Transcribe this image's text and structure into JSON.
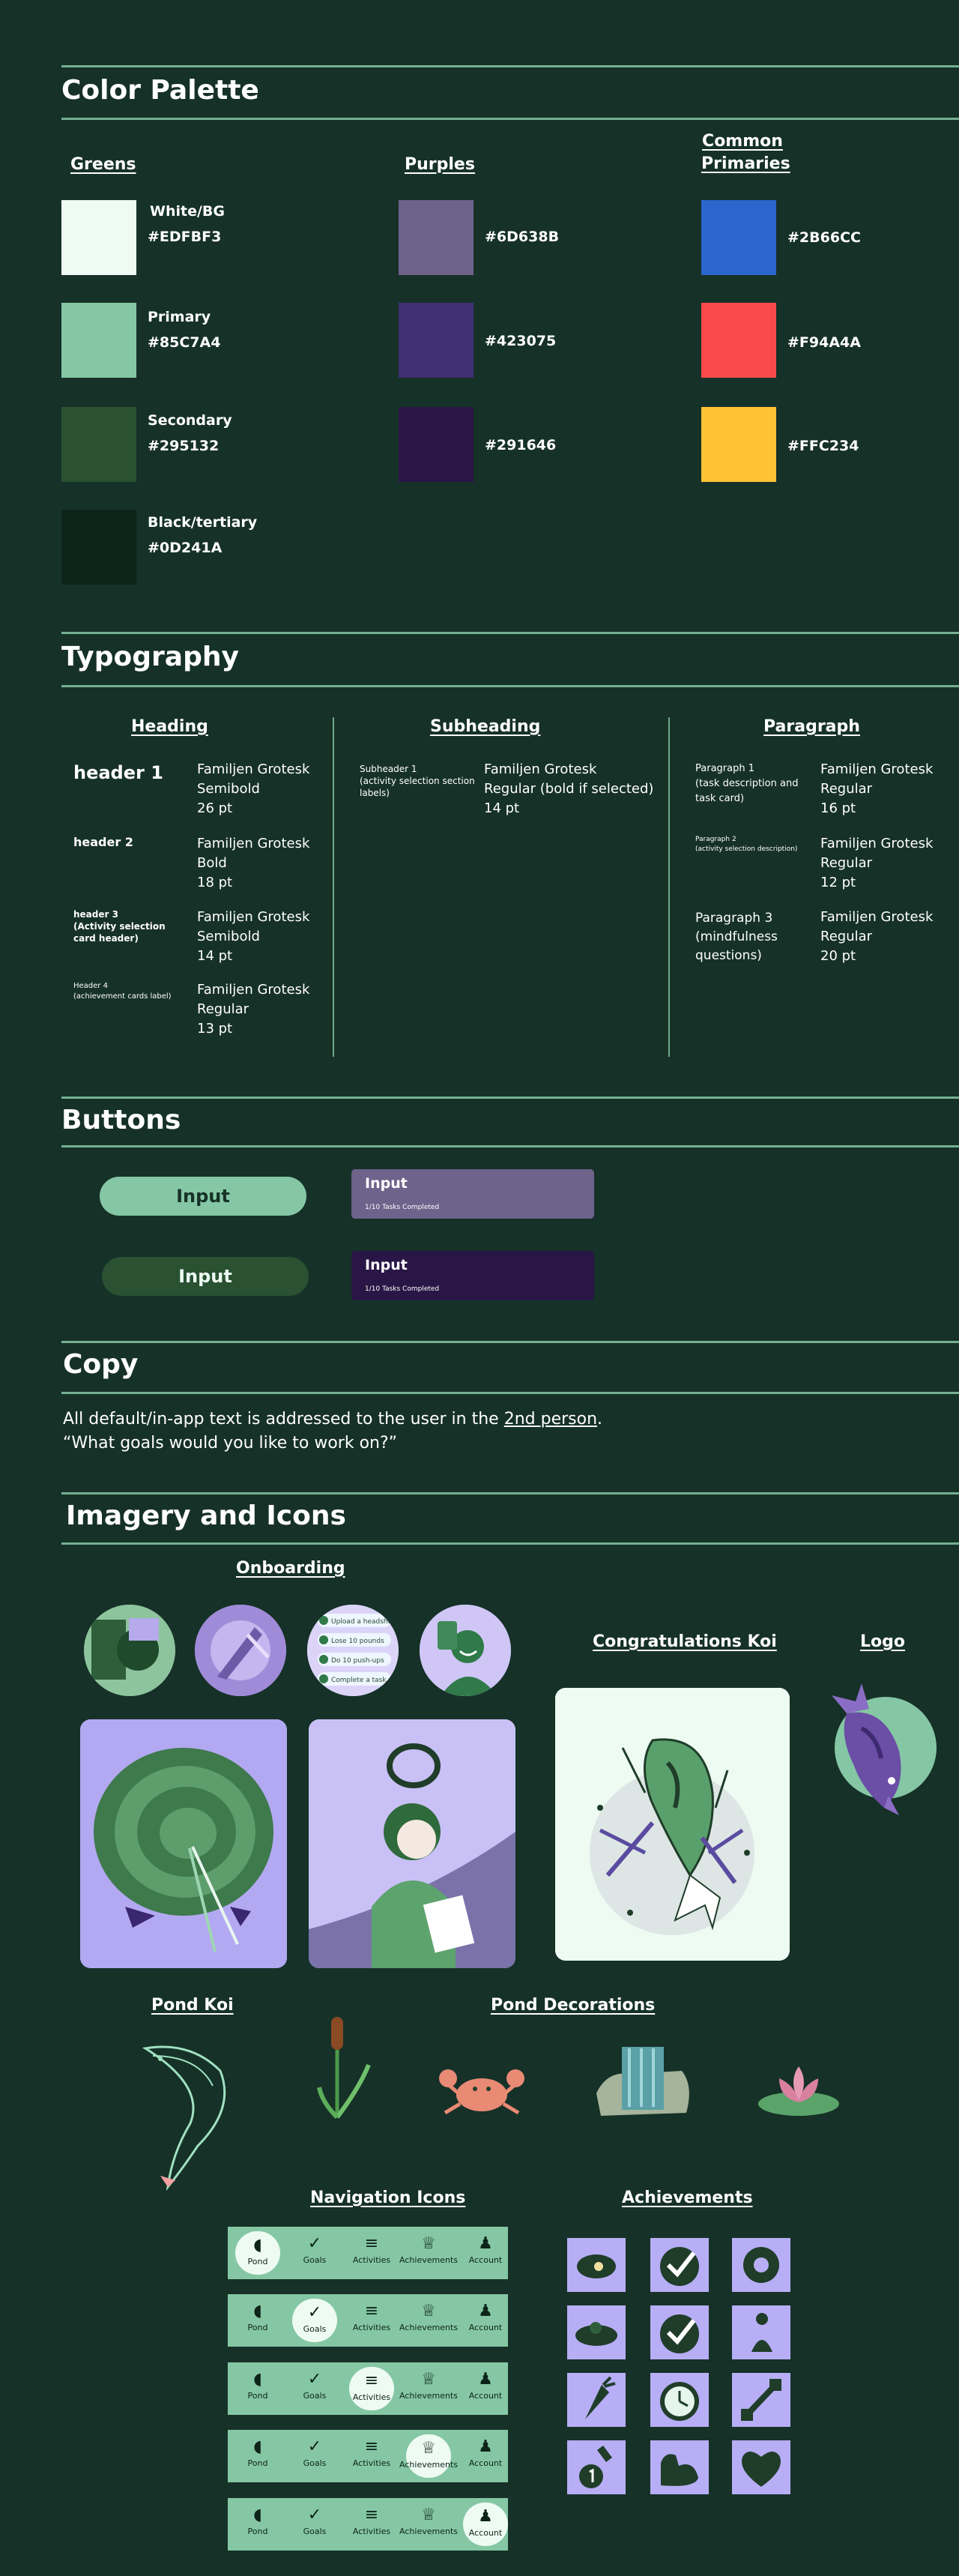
{
  "sections": {
    "color": "Color Palette",
    "typography": "Typography",
    "buttons": "Buttons",
    "copy": "Copy",
    "imagery": "Imagery and Icons"
  },
  "palette": {
    "greens_title": "Greens",
    "purples_title": "Purples",
    "primaries_title_1": "Common",
    "primaries_title_2": "Primaries",
    "greens": [
      {
        "name": "White/BG",
        "hex": "#EDFBF3"
      },
      {
        "name": "Primary",
        "hex": "#85C7A4"
      },
      {
        "name": "Secondary",
        "hex": "#295132"
      },
      {
        "name": "Black/tertiary",
        "hex": "#0D241A"
      }
    ],
    "purples": [
      {
        "hex": "#6D638B"
      },
      {
        "hex": "#423075"
      },
      {
        "hex": "#291646"
      }
    ],
    "primaries": [
      {
        "hex": "#2B66CC"
      },
      {
        "hex": "#F94A4A"
      },
      {
        "hex": "#FFC234"
      }
    ]
  },
  "typography": {
    "heading_title": "Heading",
    "subheading_title": "Subheading",
    "paragraph_title": "Paragraph",
    "headings": [
      {
        "name": "header 1",
        "font": "Familjen Grotesk",
        "weight": "Semibold",
        "size": "26 pt"
      },
      {
        "name": "header 2",
        "font": "Familjen Grotesk",
        "weight": "Bold",
        "size": "18 pt"
      },
      {
        "name": "header 3\n(Activity selection card header)",
        "font": "Familjen Grotesk",
        "weight": "Semibold",
        "size": "14 pt"
      },
      {
        "name": "Header 4\n(achievement cards label)",
        "font": "Familjen Grotesk",
        "weight": "Regular",
        "size": "13 pt"
      }
    ],
    "subheading": {
      "name": "Subheader 1\n(activity selection section labels)",
      "font": "Familjen Grotesk",
      "weight": "Regular (bold if selected)",
      "size": "14 pt"
    },
    "paragraphs": [
      {
        "name": "Paragraph 1\n(task description and task card)",
        "font": "Familjen Grotesk",
        "weight": "Regular",
        "size": "16 pt"
      },
      {
        "name": "Paragraph 2\n(activity selection description)",
        "font": "Familjen Grotesk",
        "weight": "Regular",
        "size": "12 pt"
      },
      {
        "name": "Paragraph 3\n(mindfulness questions)",
        "font": "Familjen Grotesk",
        "weight": "Regular",
        "size": "20 pt"
      }
    ]
  },
  "buttons": {
    "pill_primary": "Input",
    "pill_secondary": "Input",
    "card_light_title": "Input",
    "card_light_sub": "1/10 Tasks Completed",
    "card_dark_title": "Input",
    "card_dark_sub": "1/10 Tasks Completed"
  },
  "copy": {
    "line1_pre": "All default/in-app text is addressed to the user in the ",
    "line1_link": "2nd person",
    "line1_post": ".",
    "line2": "“What goals would you like to work on?”"
  },
  "imagery": {
    "onboarding": "Onboarding",
    "congrats_koi": "Congratulations Koi",
    "logo": "Logo",
    "pond_koi": "Pond Koi",
    "pond_decorations": "Pond Decorations",
    "navigation_icons": "Navigation Icons",
    "achievements": "Achievements",
    "checklist": [
      "Upload a headshot",
      "Lose 10 pounds",
      "Do 10 push-ups",
      "Complete a task"
    ]
  },
  "nav": {
    "labels": [
      "Pond",
      "Goals",
      "Activities",
      "Achievements",
      "Account"
    ],
    "active_rows": [
      0,
      1,
      2,
      3,
      4
    ]
  },
  "colors": {
    "background": "#163128",
    "accent": "#85C7A4",
    "lavender": "#b7aef5"
  }
}
